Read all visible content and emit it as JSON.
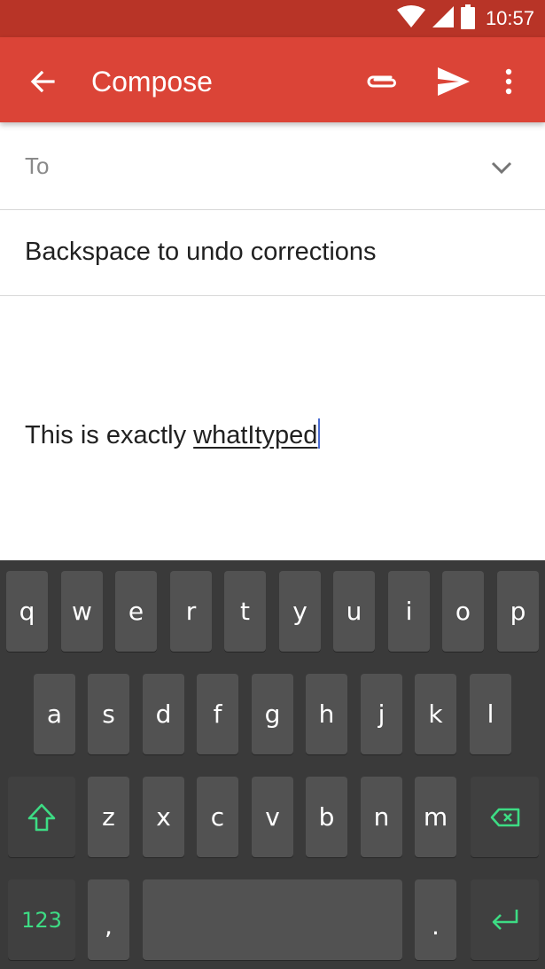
{
  "status_bar": {
    "time": "10:57",
    "icons": [
      "wifi-icon",
      "cell-signal-icon",
      "battery-icon"
    ]
  },
  "app_bar": {
    "title": "Compose",
    "actions": [
      "attach-icon",
      "send-icon",
      "more-vert-icon"
    ]
  },
  "compose": {
    "to_label": "To",
    "subject": "Backspace to undo corrections",
    "body_prefix": "This is exactly ",
    "body_composing": "whatItyped"
  },
  "keyboard": {
    "row1": [
      "q",
      "w",
      "e",
      "r",
      "t",
      "y",
      "u",
      "i",
      "o",
      "p"
    ],
    "row2": [
      "a",
      "s",
      "d",
      "f",
      "g",
      "h",
      "j",
      "k",
      "l"
    ],
    "row3": [
      "z",
      "x",
      "c",
      "v",
      "b",
      "n",
      "m"
    ],
    "symbols_label": "123",
    "comma_label": ",",
    "period_label": ".",
    "accent_color": "#3ddc84"
  },
  "colors": {
    "app_bar": "#db4437",
    "status_bar": "#b83427",
    "keyboard_bg": "#3a3a3a",
    "key_bg": "#525252",
    "caret": "#4a6bd1"
  }
}
